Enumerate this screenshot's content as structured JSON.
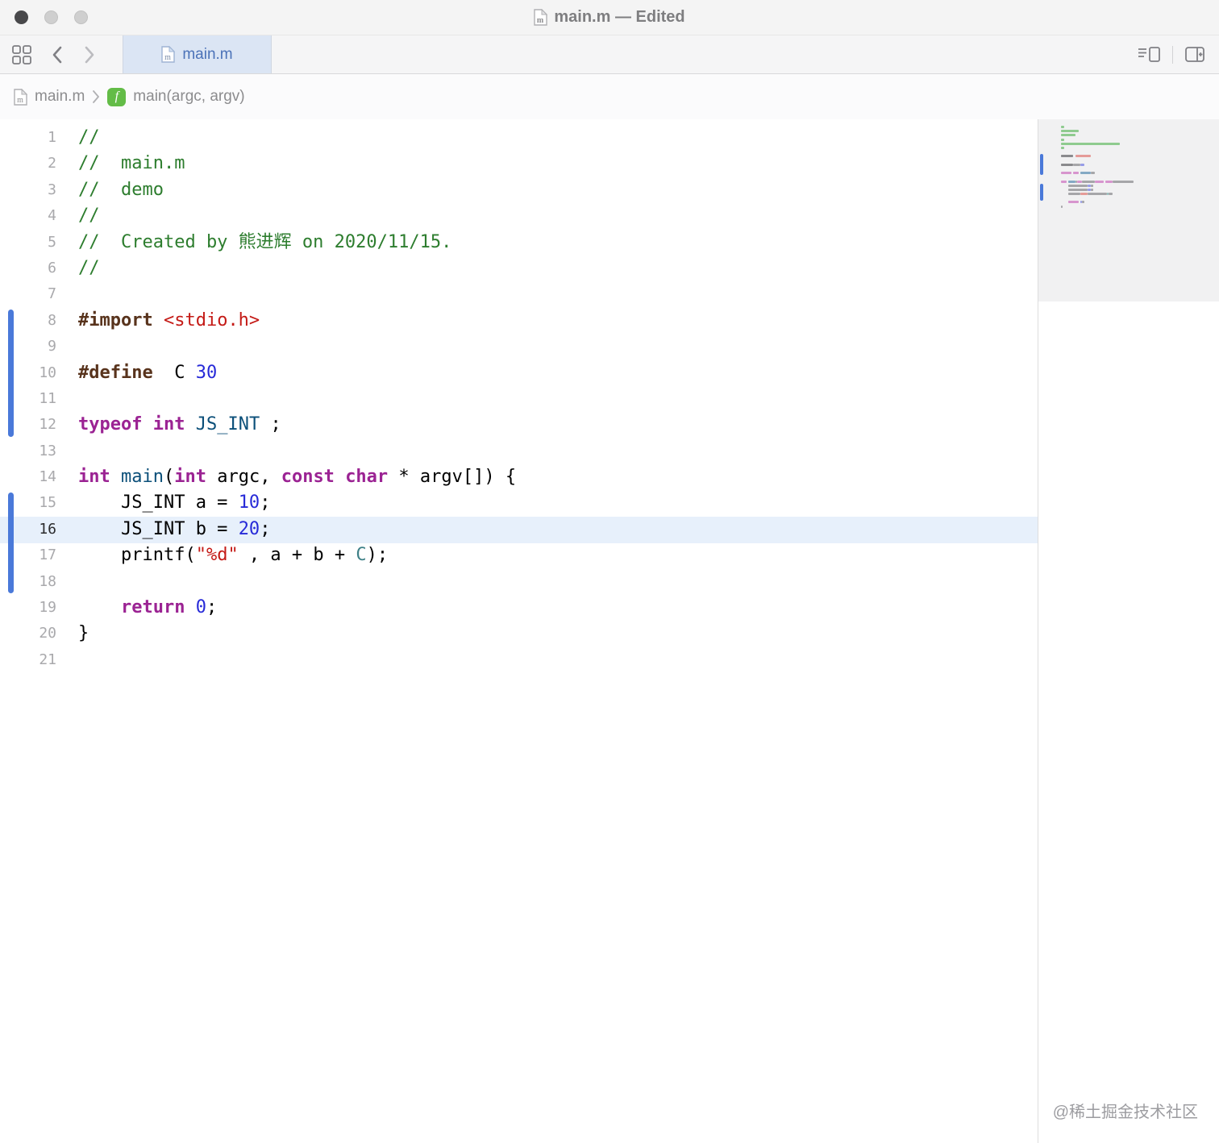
{
  "window": {
    "title": "main.m — Edited"
  },
  "toolbar": {
    "tab_label": "main.m"
  },
  "breadcrumb": {
    "file": "main.m",
    "symbol": "main(argc, argv)"
  },
  "editor": {
    "current_line": 16,
    "change_bars": [
      {
        "from": 8,
        "to": 12
      },
      {
        "from": 15,
        "to": 18
      }
    ],
    "lines": [
      {
        "n": 1,
        "segs": [
          {
            "t": "//",
            "c": "comment"
          }
        ]
      },
      {
        "n": 2,
        "segs": [
          {
            "t": "//  main.m",
            "c": "comment"
          }
        ]
      },
      {
        "n": 3,
        "segs": [
          {
            "t": "//  demo",
            "c": "comment"
          }
        ]
      },
      {
        "n": 4,
        "segs": [
          {
            "t": "//",
            "c": "comment"
          }
        ]
      },
      {
        "n": 5,
        "segs": [
          {
            "t": "//  Created by 熊进辉 on 2020/11/15.",
            "c": "comment"
          }
        ]
      },
      {
        "n": 6,
        "segs": [
          {
            "t": "//",
            "c": "comment"
          }
        ]
      },
      {
        "n": 7,
        "segs": []
      },
      {
        "n": 8,
        "segs": [
          {
            "t": "#import",
            "c": "preproc"
          },
          {
            "t": " ",
            "c": "plain"
          },
          {
            "t": "<stdio.h>",
            "c": "string"
          }
        ]
      },
      {
        "n": 9,
        "segs": []
      },
      {
        "n": 10,
        "segs": [
          {
            "t": "#define",
            "c": "preproc"
          },
          {
            "t": "  C ",
            "c": "plain"
          },
          {
            "t": "30",
            "c": "number"
          }
        ]
      },
      {
        "n": 11,
        "segs": []
      },
      {
        "n": 12,
        "segs": [
          {
            "t": "typeof",
            "c": "keyword"
          },
          {
            "t": " ",
            "c": "plain"
          },
          {
            "t": "int",
            "c": "keyword"
          },
          {
            "t": " ",
            "c": "plain"
          },
          {
            "t": "JS_INT",
            "c": "type"
          },
          {
            "t": " ;",
            "c": "plain"
          }
        ]
      },
      {
        "n": 13,
        "segs": []
      },
      {
        "n": 14,
        "segs": [
          {
            "t": "int",
            "c": "keyword"
          },
          {
            "t": " ",
            "c": "plain"
          },
          {
            "t": "main",
            "c": "func"
          },
          {
            "t": "(",
            "c": "plain"
          },
          {
            "t": "int",
            "c": "keyword"
          },
          {
            "t": " argc, ",
            "c": "plain"
          },
          {
            "t": "const",
            "c": "keyword"
          },
          {
            "t": " ",
            "c": "plain"
          },
          {
            "t": "char",
            "c": "keyword"
          },
          {
            "t": " * argv[]) {",
            "c": "plain"
          }
        ]
      },
      {
        "n": 15,
        "segs": [
          {
            "t": "    JS_INT a = ",
            "c": "plain"
          },
          {
            "t": "10",
            "c": "number"
          },
          {
            "t": ";",
            "c": "plain"
          }
        ]
      },
      {
        "n": 16,
        "segs": [
          {
            "t": "    JS_INT b = ",
            "c": "plain"
          },
          {
            "t": "20",
            "c": "number"
          },
          {
            "t": ";",
            "c": "plain"
          }
        ]
      },
      {
        "n": 17,
        "segs": [
          {
            "t": "    printf(",
            "c": "plain"
          },
          {
            "t": "\"%d\"",
            "c": "string"
          },
          {
            "t": " , a + b + ",
            "c": "plain"
          },
          {
            "t": "C",
            "c": "macro"
          },
          {
            "t": ");",
            "c": "plain"
          }
        ]
      },
      {
        "n": 18,
        "segs": []
      },
      {
        "n": 19,
        "segs": [
          {
            "t": "    ",
            "c": "plain"
          },
          {
            "t": "return",
            "c": "keyword"
          },
          {
            "t": " ",
            "c": "plain"
          },
          {
            "t": "0",
            "c": "number"
          },
          {
            "t": ";",
            "c": "plain"
          }
        ]
      },
      {
        "n": 20,
        "segs": [
          {
            "t": "}",
            "c": "plain"
          }
        ]
      },
      {
        "n": 21,
        "segs": []
      }
    ]
  },
  "colors": {
    "accent_blue": "#4A79D9",
    "current_line_bg": "#E7F0FB",
    "tab_selected_bg": "#DBE5F4",
    "comment": "#2D7D2E",
    "keyword": "#9B2393",
    "preprocessor": "#58331C",
    "string": "#C41A16",
    "number": "#272AD8",
    "type_name": "#0B4F79",
    "macro": "#3E8087",
    "function_badge_green": "#63BC47"
  },
  "watermark": "@稀土掘金技术社区"
}
